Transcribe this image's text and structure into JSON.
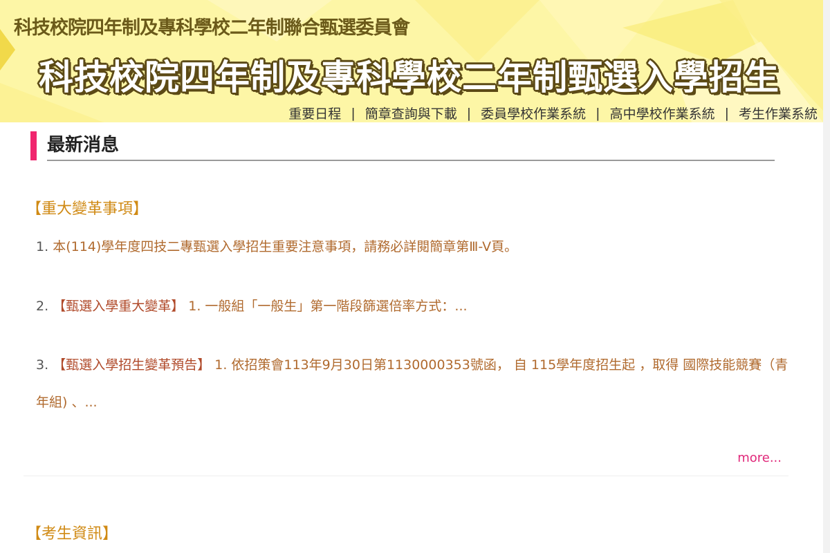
{
  "banner": {
    "subtitle": "科技校院四年制及專科學校二年制聯合甄選委員會",
    "title": "科技校院四年制及專科學校二年制甄選入學招生"
  },
  "nav": {
    "items": [
      {
        "label": "重要日程"
      },
      {
        "label": "簡章查詢與下載"
      },
      {
        "label": "委員學校作業系統"
      },
      {
        "label": "高中學校作業系統"
      },
      {
        "label": "考生作業系統"
      }
    ],
    "separator": "|"
  },
  "section": {
    "title": "最新消息"
  },
  "news": {
    "category1": "【重大變革事項】",
    "items": [
      {
        "num": "1.",
        "tag": "",
        "text": "本(114)學年度四技二專甄選入學招生重要注意事項，請務必詳閱簡章第Ⅲ-V頁。"
      },
      {
        "num": "2.",
        "tag": "【甄選入學重大變革】",
        "text": "1. 一般組「一般生」第一階段篩選倍率方式：..."
      },
      {
        "num": "3.",
        "tag": "【甄選入學招生變革預告】",
        "text": "1. 依招策會113年9月30日第1130000353號函， 自 115學年度招生起 ，取得 國際技能競賽（青年組) 、..."
      }
    ],
    "more": "more...",
    "category2": "【考生資訊】"
  },
  "colors": {
    "accent": "#f0266e",
    "category": "#d08a14",
    "link": "#b06a2e",
    "banner_bg": "#fdf6a6"
  }
}
